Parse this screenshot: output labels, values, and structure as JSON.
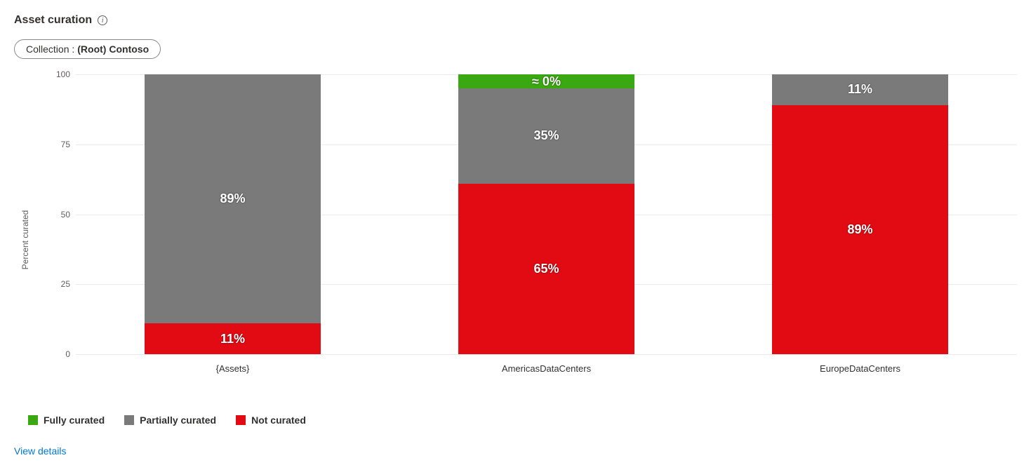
{
  "header": {
    "title": "Asset curation",
    "info_icon_label": "info"
  },
  "filter": {
    "label": "Collection :",
    "value": "(Root) Contoso"
  },
  "chart_data": {
    "type": "bar",
    "stacked": true,
    "orientation": "vertical",
    "title": "",
    "ylabel": "Percent curated",
    "xlabel": "",
    "ylim": [
      0,
      100
    ],
    "yticks": [
      0,
      25,
      50,
      75,
      100
    ],
    "categories": [
      "{Assets}",
      "AmericasDataCenters",
      "EuropeDataCenters"
    ],
    "series": [
      {
        "name": "Fully curated",
        "color": "#3aa810",
        "values": [
          0,
          0.4,
          0
        ],
        "display_labels": [
          "",
          "≈ 0%",
          ""
        ]
      },
      {
        "name": "Partially curated",
        "color": "#7a7a7a",
        "values": [
          89,
          35,
          11
        ],
        "display_labels": [
          "89%",
          "35%",
          "11%"
        ]
      },
      {
        "name": "Not curated",
        "color": "#e30b13",
        "values": [
          11,
          65,
          89
        ],
        "display_labels": [
          "11%",
          "65%",
          "89%"
        ]
      }
    ],
    "segments_by_bar_top_to_bottom": [
      [
        {
          "series": "Partially curated",
          "value": 89,
          "label": "89%",
          "color": "gray"
        },
        {
          "series": "Not curated",
          "value": 11,
          "label": "11%",
          "color": "red"
        }
      ],
      [
        {
          "series": "Fully curated",
          "value": 5,
          "label": "≈ 0%",
          "color": "green"
        },
        {
          "series": "Partially curated",
          "value": 34,
          "label": "35%",
          "color": "gray"
        },
        {
          "series": "Not curated",
          "value": 61,
          "label": "65%",
          "color": "red"
        }
      ],
      [
        {
          "series": "Partially curated",
          "value": 11,
          "label": "11%",
          "color": "gray"
        },
        {
          "series": "Not curated",
          "value": 89,
          "label": "89%",
          "color": "red"
        }
      ]
    ]
  },
  "legend": {
    "items": [
      {
        "name": "Fully curated",
        "color": "#3aa810"
      },
      {
        "name": "Partially curated",
        "color": "#7a7a7a"
      },
      {
        "name": "Not curated",
        "color": "#e30b13"
      }
    ]
  },
  "link": {
    "view_details": "View details"
  }
}
